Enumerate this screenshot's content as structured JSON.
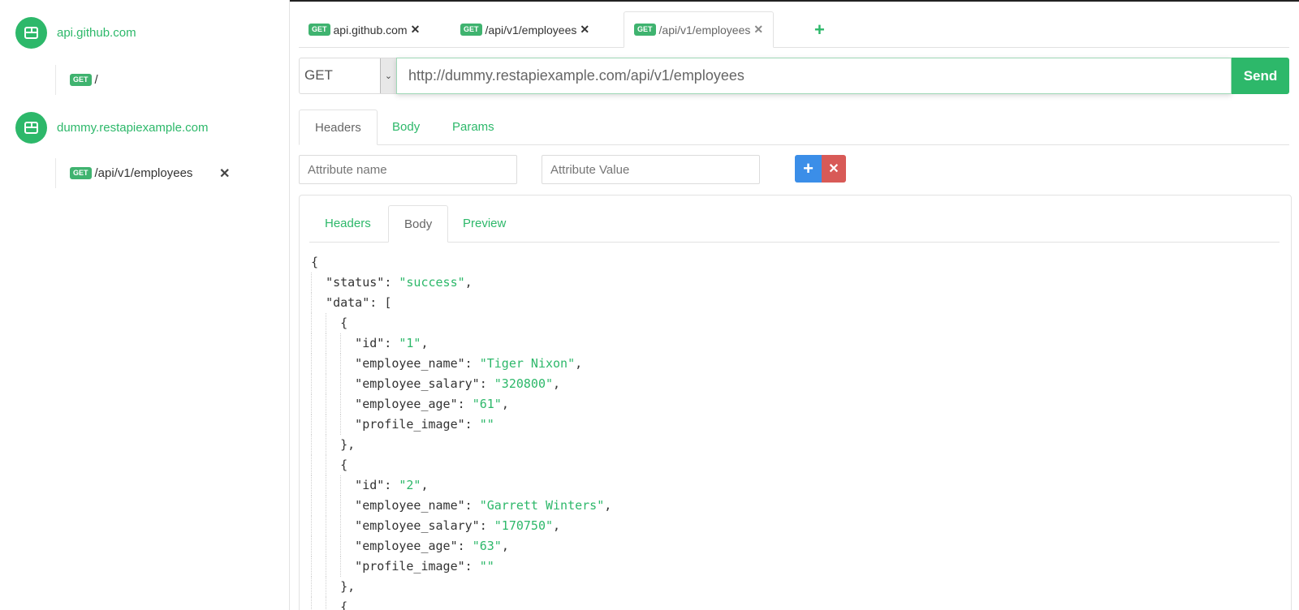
{
  "sidebar": {
    "hosts": [
      {
        "name": "api.github.com",
        "routes": [
          {
            "method": "GET",
            "path": "/"
          }
        ]
      },
      {
        "name": "dummy.restapiexample.com",
        "routes": [
          {
            "method": "GET",
            "path": "/api/v1/employees",
            "close": "✕"
          }
        ]
      }
    ]
  },
  "tabs": [
    {
      "method": "GET",
      "label": "api.github.com",
      "close": "✕"
    },
    {
      "method": "GET",
      "label": "/api/v1/employees",
      "close": "✕"
    },
    {
      "method": "GET",
      "label": "/api/v1/employees",
      "close": "✕",
      "active": true
    }
  ],
  "add_tab": "+",
  "request": {
    "method": "GET",
    "url": "http://dummy.restapiexample.com/api/v1/employees",
    "send_label": "Send",
    "tabs": [
      "Headers",
      "Body",
      "Params"
    ],
    "active_tab": "Headers",
    "attr_name_placeholder": "Attribute name",
    "attr_value_placeholder": "Attribute Value",
    "add_label": "+",
    "remove_label": "✕"
  },
  "response": {
    "tabs": [
      "Headers",
      "Body",
      "Preview"
    ],
    "active_tab": "Body",
    "json": {
      "open": "{",
      "status_key": "\"status\"",
      "status_val": "\"success\"",
      "data_key": "\"data\"",
      "data_open": "[",
      "items": [
        {
          "id": "\"1\"",
          "employee_name": "\"Tiger Nixon\"",
          "employee_salary": "\"320800\"",
          "employee_age": "\"61\"",
          "profile_image": "\"\""
        },
        {
          "id": "\"2\"",
          "employee_name": "\"Garrett Winters\"",
          "employee_salary": "\"170750\"",
          "employee_age": "\"63\"",
          "profile_image": "\"\""
        }
      ]
    }
  },
  "colors": {
    "accent": "#2db86a",
    "blue": "#3b8ee8",
    "red": "#d85a57"
  }
}
